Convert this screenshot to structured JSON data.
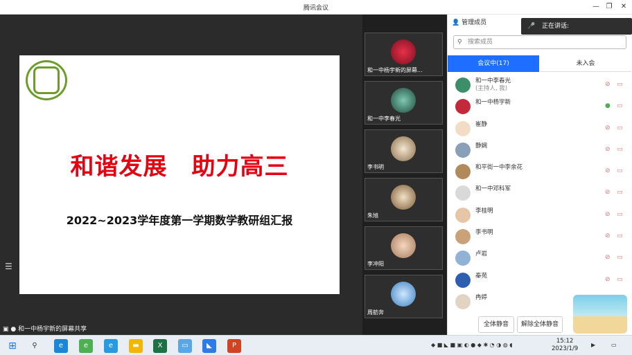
{
  "window": {
    "title": "腾讯会议",
    "min": "—",
    "max": "❐",
    "close": "✕"
  },
  "slide": {
    "headline": "和谐发展　助力高三",
    "subtitle": "2022~2023学年度第一学期数学教研组汇报"
  },
  "share_label": "和一中杨宇新的屏幕共享",
  "gallery": [
    {
      "name": "和一中杨宇新的屏幕..."
    },
    {
      "name": "和一中李春光"
    },
    {
      "name": "李书明"
    },
    {
      "name": "朱旭"
    },
    {
      "name": "李冲阳"
    },
    {
      "name": "周舫奔"
    }
  ],
  "panel": {
    "title": "管理成员",
    "speaking": "正在讲话:",
    "search_placeholder": "搜索成员",
    "tab_in": "会议中(17)",
    "tab_out": "未入会",
    "members": [
      {
        "name": "和一中李春光",
        "note": "(主持人, 我)"
      },
      {
        "name": "和一中杨宇新",
        "note": ""
      },
      {
        "name": "崔静",
        "note": ""
      },
      {
        "name": "静娴",
        "note": ""
      },
      {
        "name": "和平街一中李余花",
        "note": ""
      },
      {
        "name": "和一中邓科军",
        "note": ""
      },
      {
        "name": "李桂明",
        "note": ""
      },
      {
        "name": "李书明",
        "note": ""
      },
      {
        "name": "卢岩",
        "note": ""
      },
      {
        "name": "秦苑",
        "note": ""
      },
      {
        "name": "冉婷",
        "note": ""
      }
    ],
    "btn_mute_all": "全体静音",
    "btn_unmute_all": "解除全体静音"
  },
  "taskbar": {
    "time": "15:12",
    "date": "2023/1/9"
  }
}
